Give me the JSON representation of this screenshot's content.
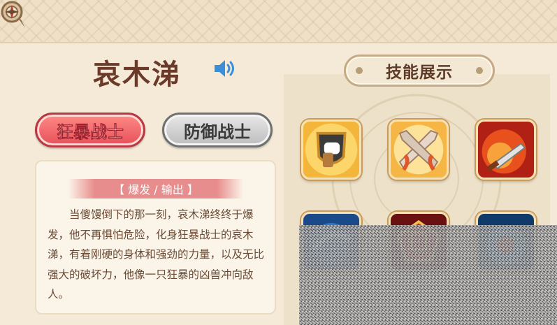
{
  "character": {
    "name": "哀木涕",
    "voice_icon": "speaker-icon"
  },
  "roles": [
    {
      "label": "狂暴战士",
      "selected": true
    },
    {
      "label": "防御战士",
      "selected": false
    }
  ],
  "description": {
    "tag": "【 爆发 / 输出 】",
    "text": "当傻馒倒下的那一刻，哀木涕终终于爆发，他不再惧怕危险，化身狂暴战士的哀木涕，有着刚硬的身体和强劲的力量，以及无比强大的破坏力，他像一只狂暴的凶兽冲向敌人。"
  },
  "skills": {
    "title": "技能展示",
    "icons": [
      "shield-fist-icon",
      "crossed-swords-icon",
      "fire-sword-icon",
      "water-swirl-icon",
      "red-rune-icon",
      "blue-vortex-icon"
    ]
  },
  "colors": {
    "accent_red": "#e6505a",
    "name_brown": "#6b3a2a",
    "text_brown": "#6a4a35",
    "background": "#f4ead7"
  }
}
